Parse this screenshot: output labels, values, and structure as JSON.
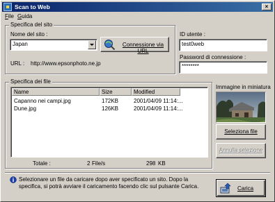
{
  "window": {
    "title": "Scan to Web",
    "close_glyph": "×"
  },
  "menu": [
    {
      "label": "File",
      "underline": "F",
      "rest": "ile"
    },
    {
      "label": "Guida",
      "underline": "G",
      "rest": "uida"
    }
  ],
  "site_group": {
    "title": "Specifica del sito",
    "site_name_label": "Nome del sito :",
    "site_name_value": "Japan",
    "connect_button": "Connessione via URL",
    "url_label": "URL :",
    "url_value": "http://www.epsonphoto.ne.jp"
  },
  "login": {
    "user_id_label": "ID utente :",
    "user_id_value": "test0web",
    "password_label": "Password di connessione :",
    "password_value": "********"
  },
  "file_group": {
    "title": "Specifica dei file",
    "columns": [
      "Name",
      "Size",
      "Modified"
    ],
    "rows": [
      {
        "name": "Capanno nei campi.jpg",
        "size": "172KB",
        "modified": "2001/04/09 11:14:..."
      },
      {
        "name": "Dune.jpg",
        "size": "126KB",
        "modified": "2001/04/09 11:14:..."
      }
    ],
    "totals_label": "Totale :",
    "totals_count": "2",
    "totals_unit": "File/s",
    "totals_size": "298",
    "totals_size_unit": "KB"
  },
  "thumbnail": {
    "label": "Immagine in miniatura"
  },
  "buttons": {
    "select_file": "Seleziona file",
    "cancel_selection": "Annulla selezione",
    "upload": "Carica"
  },
  "info": {
    "icon": "info-icon",
    "text": "Selezionare un file da caricare dopo aver specificato un sito. Dopo la specifica, si potrà avviare il caricamento facendo clic sul pulsante Carica."
  },
  "colors": {
    "titlebar_start": "#0a246a",
    "titlebar_end": "#3a6ea5",
    "face": "#d4d0c8"
  }
}
